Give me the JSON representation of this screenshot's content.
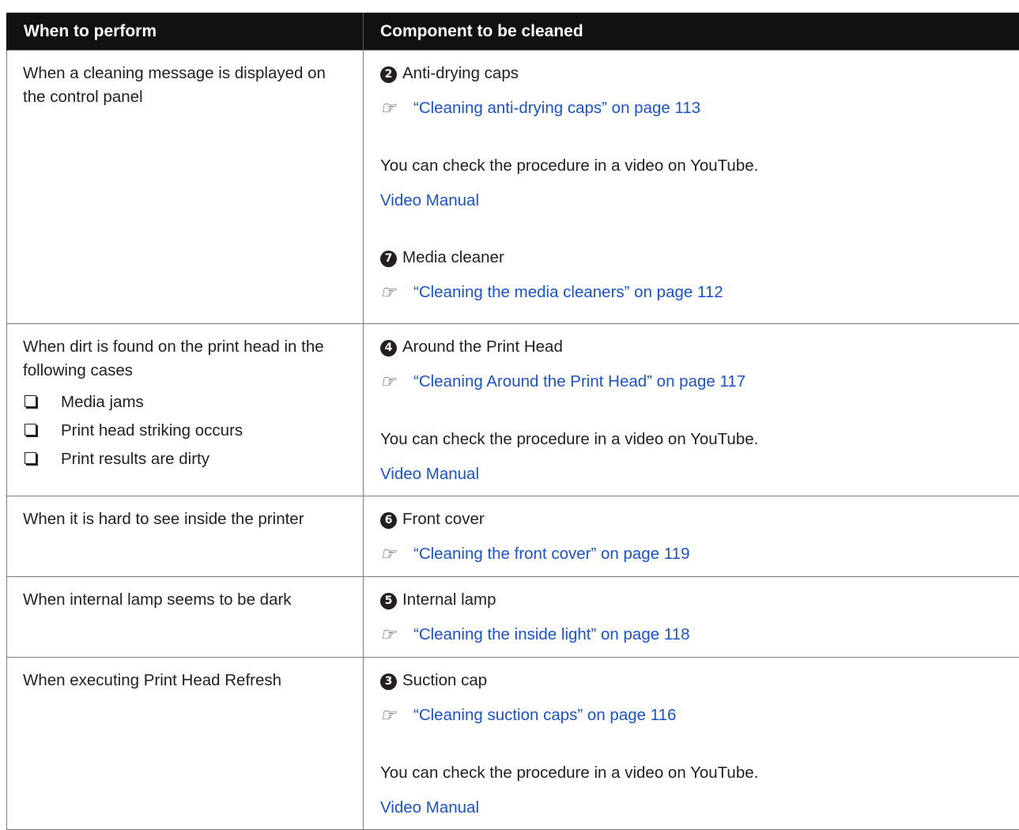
{
  "table": {
    "headers": [
      "When to perform",
      "Component to be cleaned"
    ],
    "rows": [
      {
        "when": "When a cleaning message is displayed on the control panel",
        "items": [
          {
            "number": "2",
            "name": "Anti-drying caps",
            "link": "“Cleaning anti-drying caps” on page 113",
            "video_text": "You can check the procedure in a video on YouTube.",
            "video_link": "Video Manual"
          },
          {
            "number": "7",
            "name": "Media cleaner",
            "link": "“Cleaning the media cleaners” on page 112"
          }
        ]
      },
      {
        "when": "When dirt is found on the print head in the following cases",
        "cases": [
          "Media jams",
          "Print head striking occurs",
          "Print results are dirty"
        ],
        "items": [
          {
            "number": "4",
            "name": "Around the Print Head",
            "link": "“Cleaning Around the Print Head” on page 117",
            "video_text": "You can check the procedure in a video on YouTube.",
            "video_link": "Video Manual"
          }
        ]
      },
      {
        "when": "When it is hard to see inside the printer",
        "items": [
          {
            "number": "6",
            "name": "Front cover",
            "link": "“Cleaning the front cover” on page 119"
          }
        ]
      },
      {
        "when": "When internal lamp seems to be dark",
        "items": [
          {
            "number": "5",
            "name": "Internal lamp",
            "link": "“Cleaning the inside light” on page 118"
          }
        ]
      },
      {
        "when": "When executing Print Head Refresh",
        "items": [
          {
            "number": "3",
            "name": "Suction cap",
            "link": "“Cleaning suction caps” on page 116",
            "video_text": "You can check the procedure in a video on YouTube.",
            "video_link": "Video Manual"
          }
        ]
      }
    ]
  },
  "icons": {
    "reference": "reference-hand-icon",
    "callout": "numbered-callout-icon",
    "checkbox": "checkbox-bullet-icon"
  },
  "colors": {
    "header_bg": "#111111",
    "header_text": "#ffffff",
    "link": "#1a52d6",
    "border": "#7d7d7d"
  }
}
